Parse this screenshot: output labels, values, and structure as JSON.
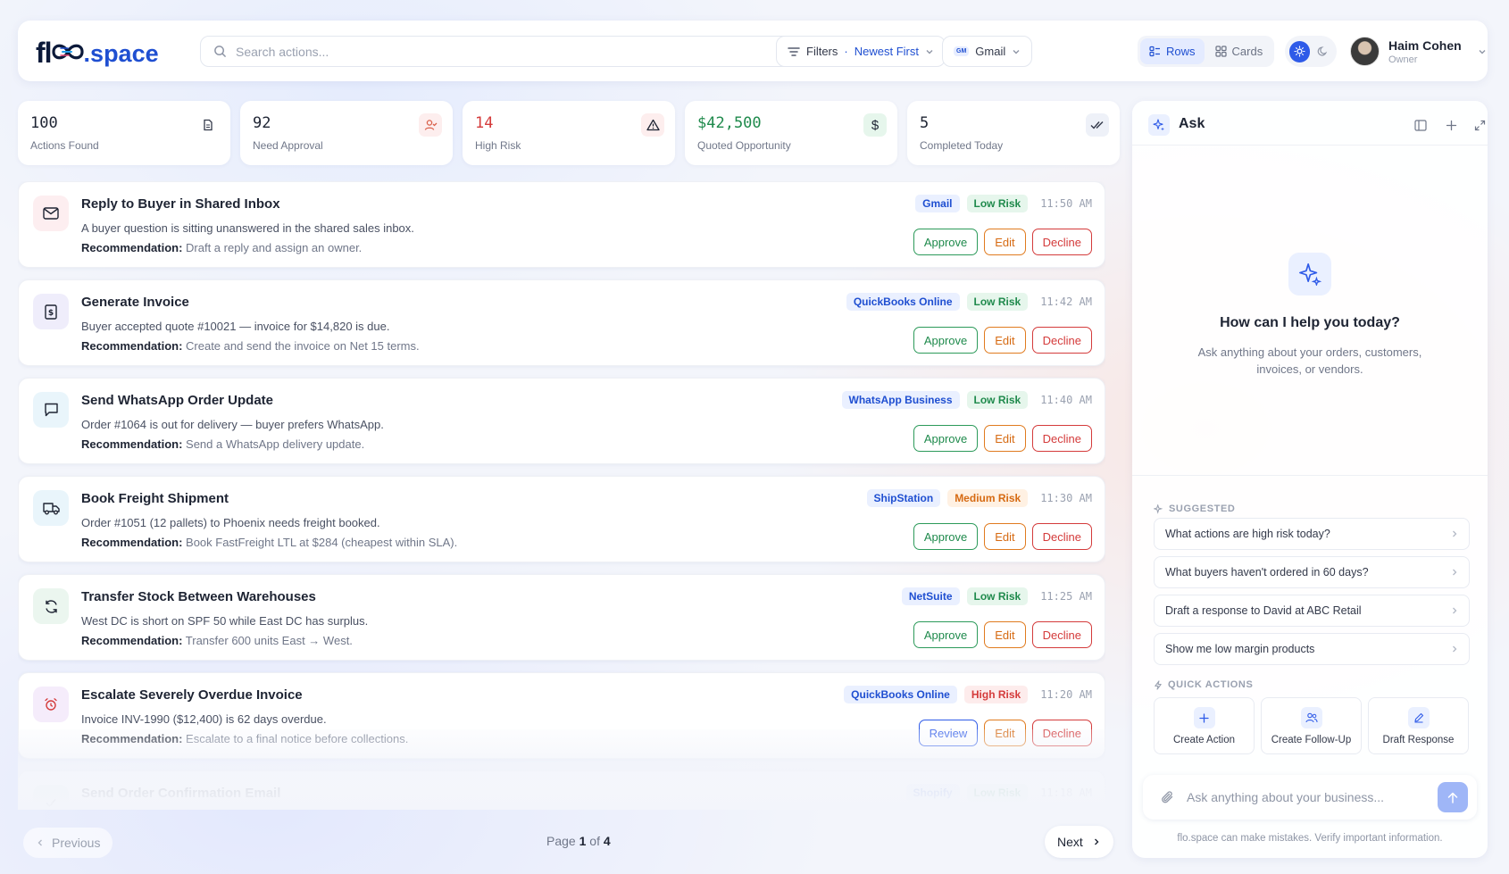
{
  "brand": {
    "fl": "fl",
    "space": ".space"
  },
  "search": {
    "placeholder": "Search actions..."
  },
  "filters": {
    "label": "Filters",
    "sort": "Newest First"
  },
  "source_filter": {
    "badge": "GM",
    "label": "Gmail"
  },
  "view": {
    "rows": "Rows",
    "cards": "Cards"
  },
  "user": {
    "name": "Haim Cohen",
    "role": "Owner"
  },
  "stats": [
    {
      "value": "100",
      "label": "Actions Found",
      "icon": "document-icon",
      "color": "#1e2433"
    },
    {
      "value": "92",
      "label": "Need Approval",
      "icon": "user-check-icon",
      "color": "#1e2433"
    },
    {
      "value": "14",
      "label": "High Risk",
      "icon": "warning-icon",
      "color": "#d43b3b"
    },
    {
      "value": "$42,500",
      "label": "Quoted Opportunity",
      "icon": "dollar-icon",
      "color": "#1f8a4c"
    },
    {
      "value": "5",
      "label": "Completed Today",
      "icon": "double-check-icon",
      "color": "#1e2433"
    }
  ],
  "actions": [
    {
      "title": "Reply to Buyer in Shared Inbox",
      "desc": "A buyer question is sitting unanswered in the shared sales inbox.",
      "rec_label": "Recommendation:",
      "rec": " Draft a reply and assign an owner.",
      "source": "Gmail",
      "risk": "Low Risk",
      "time": "11:50 AM",
      "primary": "Approve",
      "edit": "Edit",
      "decline": "Decline",
      "icon": "mail-icon"
    },
    {
      "title": "Generate Invoice",
      "desc": "Buyer accepted quote #10021 — invoice for $14,820 is due.",
      "rec_label": "Recommendation:",
      "rec": " Create and send the invoice on Net 15 terms.",
      "source": "QuickBooks Online",
      "risk": "Low Risk",
      "time": "11:42 AM",
      "primary": "Approve",
      "edit": "Edit",
      "decline": "Decline",
      "icon": "invoice-icon"
    },
    {
      "title": "Send WhatsApp Order Update",
      "desc": "Order #1064 is out for delivery — buyer prefers WhatsApp.",
      "rec_label": "Recommendation:",
      "rec": " Send a WhatsApp delivery update.",
      "source": "WhatsApp Business",
      "risk": "Low Risk",
      "time": "11:40 AM",
      "primary": "Approve",
      "edit": "Edit",
      "decline": "Decline",
      "icon": "chat-icon"
    },
    {
      "title": "Book Freight Shipment",
      "desc": "Order #1051 (12 pallets) to Phoenix needs freight booked.",
      "rec_label": "Recommendation:",
      "rec": " Book FastFreight LTL at $284 (cheapest within SLA).",
      "source": "ShipStation",
      "risk": "Medium Risk",
      "time": "11:30 AM",
      "primary": "Approve",
      "edit": "Edit",
      "decline": "Decline",
      "icon": "truck-icon"
    },
    {
      "title": "Transfer Stock Between Warehouses",
      "desc": "West DC is short on SPF 50 while East DC has surplus.",
      "rec_label": "Recommendation:",
      "rec": " Transfer 600 units East → West.",
      "source": "NetSuite",
      "risk": "Low Risk",
      "time": "11:25 AM",
      "primary": "Approve",
      "edit": "Edit",
      "decline": "Decline",
      "icon": "refresh-icon"
    },
    {
      "title": "Escalate Severely Overdue Invoice",
      "desc": "Invoice INV-1990 ($12,400) is 62 days overdue.",
      "rec_label": "Recommendation:",
      "rec": " Escalate to a final notice before collections.",
      "source": "QuickBooks Online",
      "risk": "High Risk",
      "time": "11:20 AM",
      "primary": "Review",
      "edit": "Edit",
      "decline": "Decline",
      "icon": "alarm-icon"
    },
    {
      "title": "Send Order Confirmation Email",
      "source": "Shopify",
      "risk": "Low Risk",
      "time": "11:18 AM",
      "icon": "check-icon"
    }
  ],
  "pager": {
    "prev": "Previous",
    "next": "Next",
    "page_word": "Page",
    "page": "1",
    "of_word": "of",
    "total": "4"
  },
  "ask": {
    "title": "Ask",
    "hero_title": "How can I help you today?",
    "hero_text": "Ask anything about your orders, customers, invoices, or vendors.",
    "suggested_label": "SUGGESTED",
    "suggestions": [
      "What actions are high risk today?",
      "What buyers haven't ordered in 60 days?",
      "Draft a response to David at ABC Retail",
      "Show me low margin products"
    ],
    "quick_label": "QUICK ACTIONS",
    "quick_actions": [
      "Create Action",
      "Create Follow-Up",
      "Draft Response"
    ],
    "input_placeholder": "Ask anything about your business...",
    "disclaimer": "flo.space can make mistakes. Verify important information."
  }
}
